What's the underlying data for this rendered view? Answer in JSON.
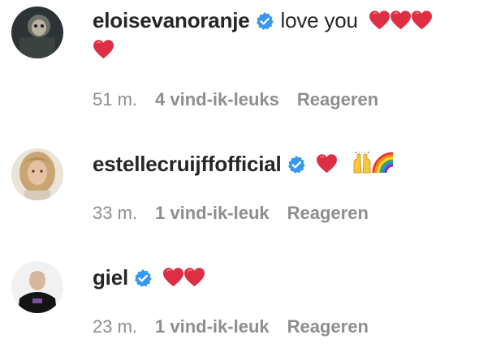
{
  "comments": [
    {
      "username": "eloisevanoranje",
      "verified": true,
      "text": "love you",
      "emoji_hearts": 4,
      "time": "51 m.",
      "likes": "4 vind-ik-leuks",
      "reply": "Reageren"
    },
    {
      "username": "estellecruijffofficial",
      "verified": true,
      "text": "",
      "emoji": [
        "red-heart",
        "raising-hands",
        "rainbow"
      ],
      "time": "33 m.",
      "likes": "1 vind-ik-leuk",
      "reply": "Reageren"
    },
    {
      "username": "giel",
      "verified": true,
      "text": "",
      "emoji_hearts": 2,
      "time": "23 m.",
      "likes": "1 vind-ik-leuk",
      "reply": "Reageren"
    }
  ],
  "colors": {
    "verified_blue": "#3897f0",
    "meta_gray": "#8e8e8e",
    "heart_red": "#e0245e"
  }
}
